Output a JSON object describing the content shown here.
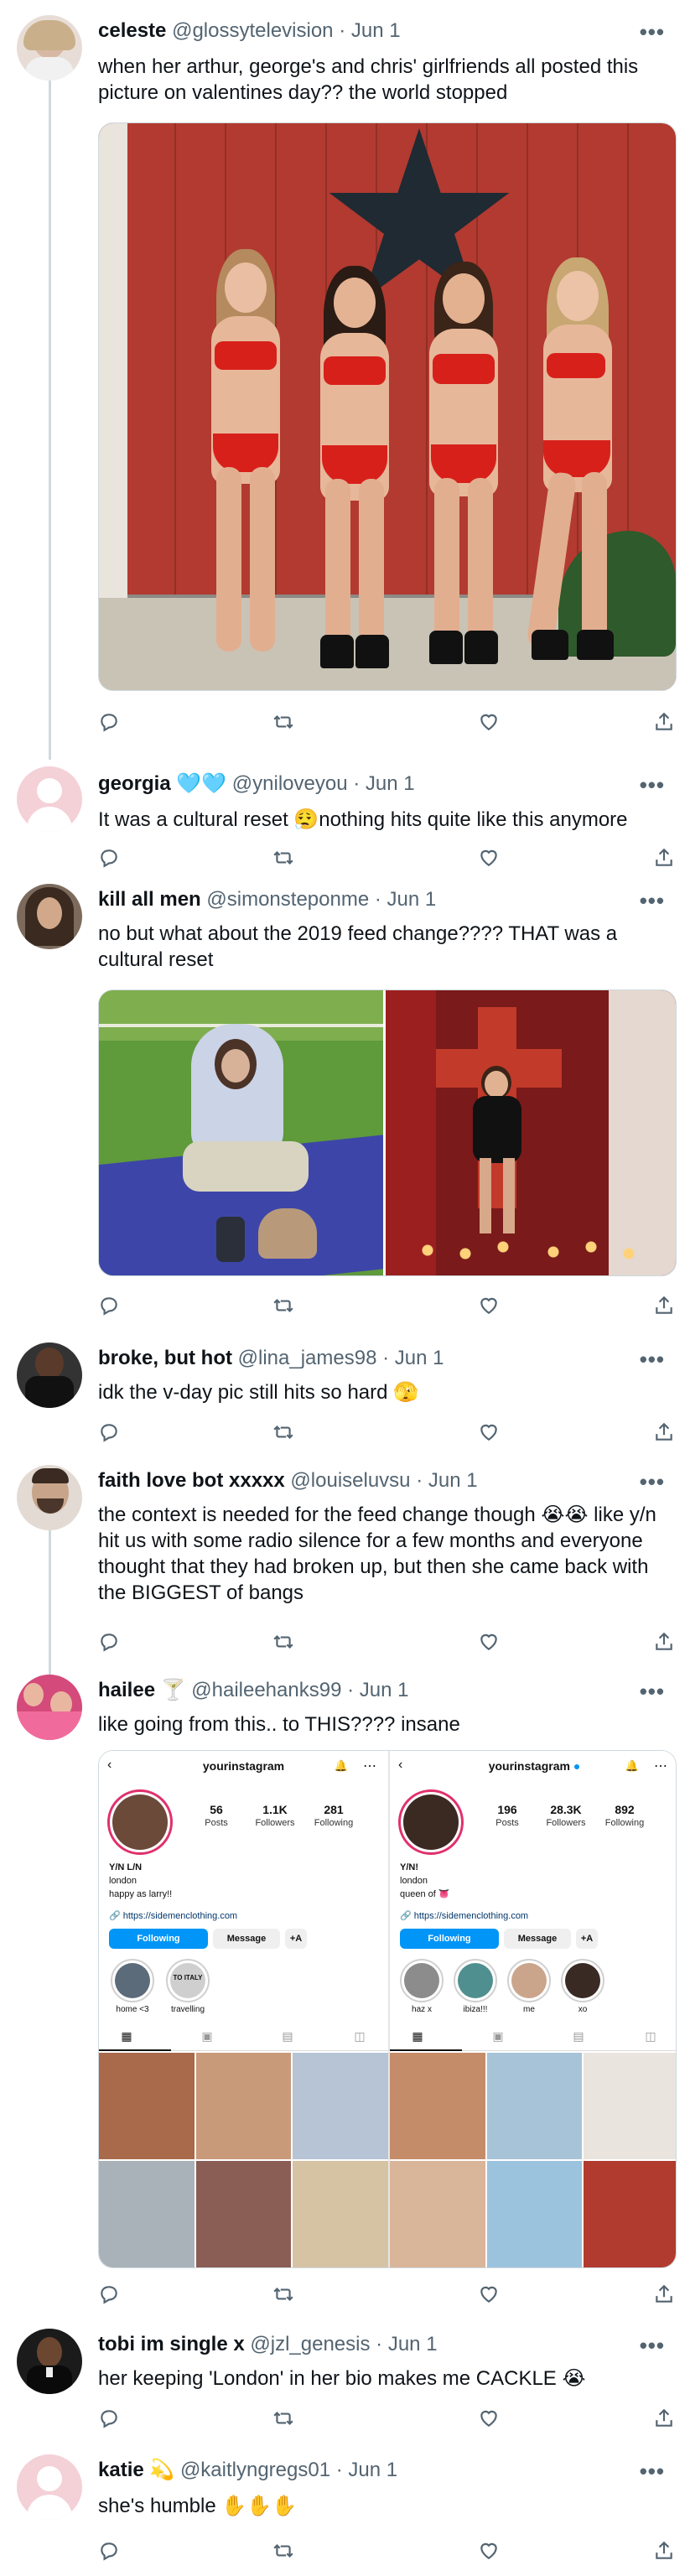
{
  "tweets": [
    {
      "name": "celeste",
      "handle": "@glossytelevision",
      "date": "Jun 1",
      "text": "when her arthur, george's and chris' girlfriends all posted this picture on valentines day?? the world stopped"
    },
    {
      "name": "georgia 🩵🩵",
      "handle": "@yniloveyou",
      "date": "Jun 1",
      "text": "It was a cultural reset 😮‍💨nothing hits quite like this anymore"
    },
    {
      "name": "kill all men",
      "handle": "@simonsteponme",
      "date": "Jun 1",
      "text": "no but what about the 2019 feed change???? THAT was a cultural reset"
    },
    {
      "name": "broke, but hot",
      "handle": "@lina_james98",
      "date": "Jun 1",
      "text": "idk the v-day pic still hits so hard 🫣"
    },
    {
      "name": "faith love bot xxxxx",
      "handle": "@louiseluvsu",
      "date": "Jun 1",
      "text": "the context is needed for the feed change though 😭😭 like y/n hit us with some radio silence for a few months and everyone thought that they had broken up, but then she came back with the BIGGEST of bangs"
    },
    {
      "name": "hailee 🍸",
      "handle": "@haileehanks99",
      "date": "Jun 1",
      "text": "like going from this.. to THIS???? insane"
    },
    {
      "name": "tobi im single x",
      "handle": "@jzl_genesis",
      "date": "Jun 1",
      "text": "her keeping 'London' in her bio makes me CACKLE 😭"
    },
    {
      "name": "katie 💫",
      "handle": "@kaitlyngregs01",
      "date": "Jun 1",
      "text": "she's humble ✋✋✋"
    }
  ],
  "ui": {
    "separator": "·",
    "more": "•••"
  },
  "instagram": {
    "before": {
      "username": "yourinstagram",
      "posts": "56",
      "posts_label": "Posts",
      "followers": "1.1K",
      "followers_label": "Followers",
      "following": "281",
      "following_label": "Following",
      "bio_name": "Y/N L/N",
      "bio_line1": "london",
      "bio_line2": "happy as larry!!",
      "link": "🔗 https://sidemenclothing.com",
      "follow_btn": "Following",
      "message_btn": "Message",
      "add_btn": "+A",
      "highlights": [
        "home <3",
        "travelling"
      ],
      "highlight_badge": "TO ITALY"
    },
    "after": {
      "username": "yourinstagram",
      "posts": "196",
      "posts_label": "Posts",
      "followers": "28.3K",
      "followers_label": "Followers",
      "following": "892",
      "following_label": "Following",
      "bio_name": "Y/N!",
      "bio_line1": "london",
      "bio_line2": "queen of 👅",
      "link": "🔗 https://sidemenclothing.com",
      "follow_btn": "Following",
      "message_btn": "Message",
      "add_btn": "+A",
      "highlights": [
        "haz x",
        "ibiza!!!",
        "me",
        "xo"
      ]
    }
  },
  "colors": {
    "accent": "#1d9bf0",
    "secondary_text": "#536471",
    "thread_line": "#cfd9de",
    "instagram_blue": "#0095f6"
  }
}
